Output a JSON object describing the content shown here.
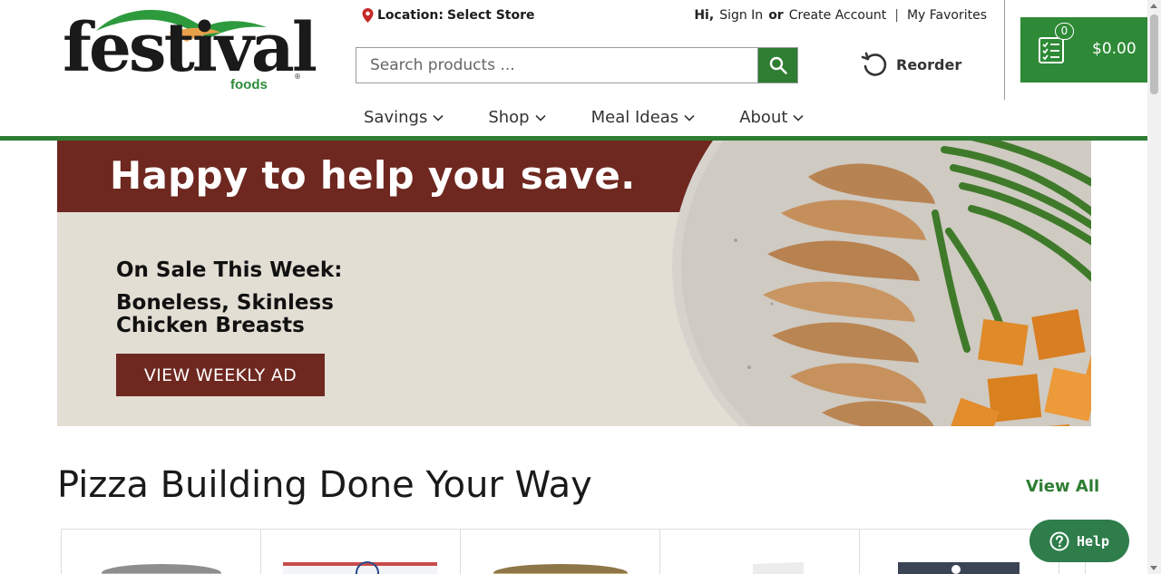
{
  "brand": {
    "logo_text": "festival",
    "logo_sub": "foods",
    "logo_reg": "®"
  },
  "location": {
    "label": "Location:",
    "value": "Select Store"
  },
  "account": {
    "greeting": "Hi,",
    "sign_in": "Sign In",
    "or": "or",
    "create_account": "Create Account",
    "separator": "|",
    "favorites": "My Favorites"
  },
  "search": {
    "placeholder": "Search products ...",
    "value": ""
  },
  "reorder": {
    "label": "Reorder"
  },
  "cart": {
    "count": "0",
    "total": "$0.00"
  },
  "nav": {
    "items": [
      {
        "label": "Savings"
      },
      {
        "label": "Shop"
      },
      {
        "label": "Meal Ideas"
      },
      {
        "label": "About"
      }
    ]
  },
  "hero": {
    "title": "Happy to help you save.",
    "sale_label": "On Sale This Week:",
    "product": "Boneless, Skinless Chicken Breasts",
    "button": "VIEW WEEKLY AD"
  },
  "section": {
    "title": "Pizza Building Done Your Way",
    "view_all": "View All"
  },
  "help": {
    "label": "Help"
  },
  "colors": {
    "brand_green": "#2e7d32",
    "cart_green": "#2e8a36",
    "hero_maroon": "#6e2820",
    "hero_bg": "#e3ded4"
  }
}
